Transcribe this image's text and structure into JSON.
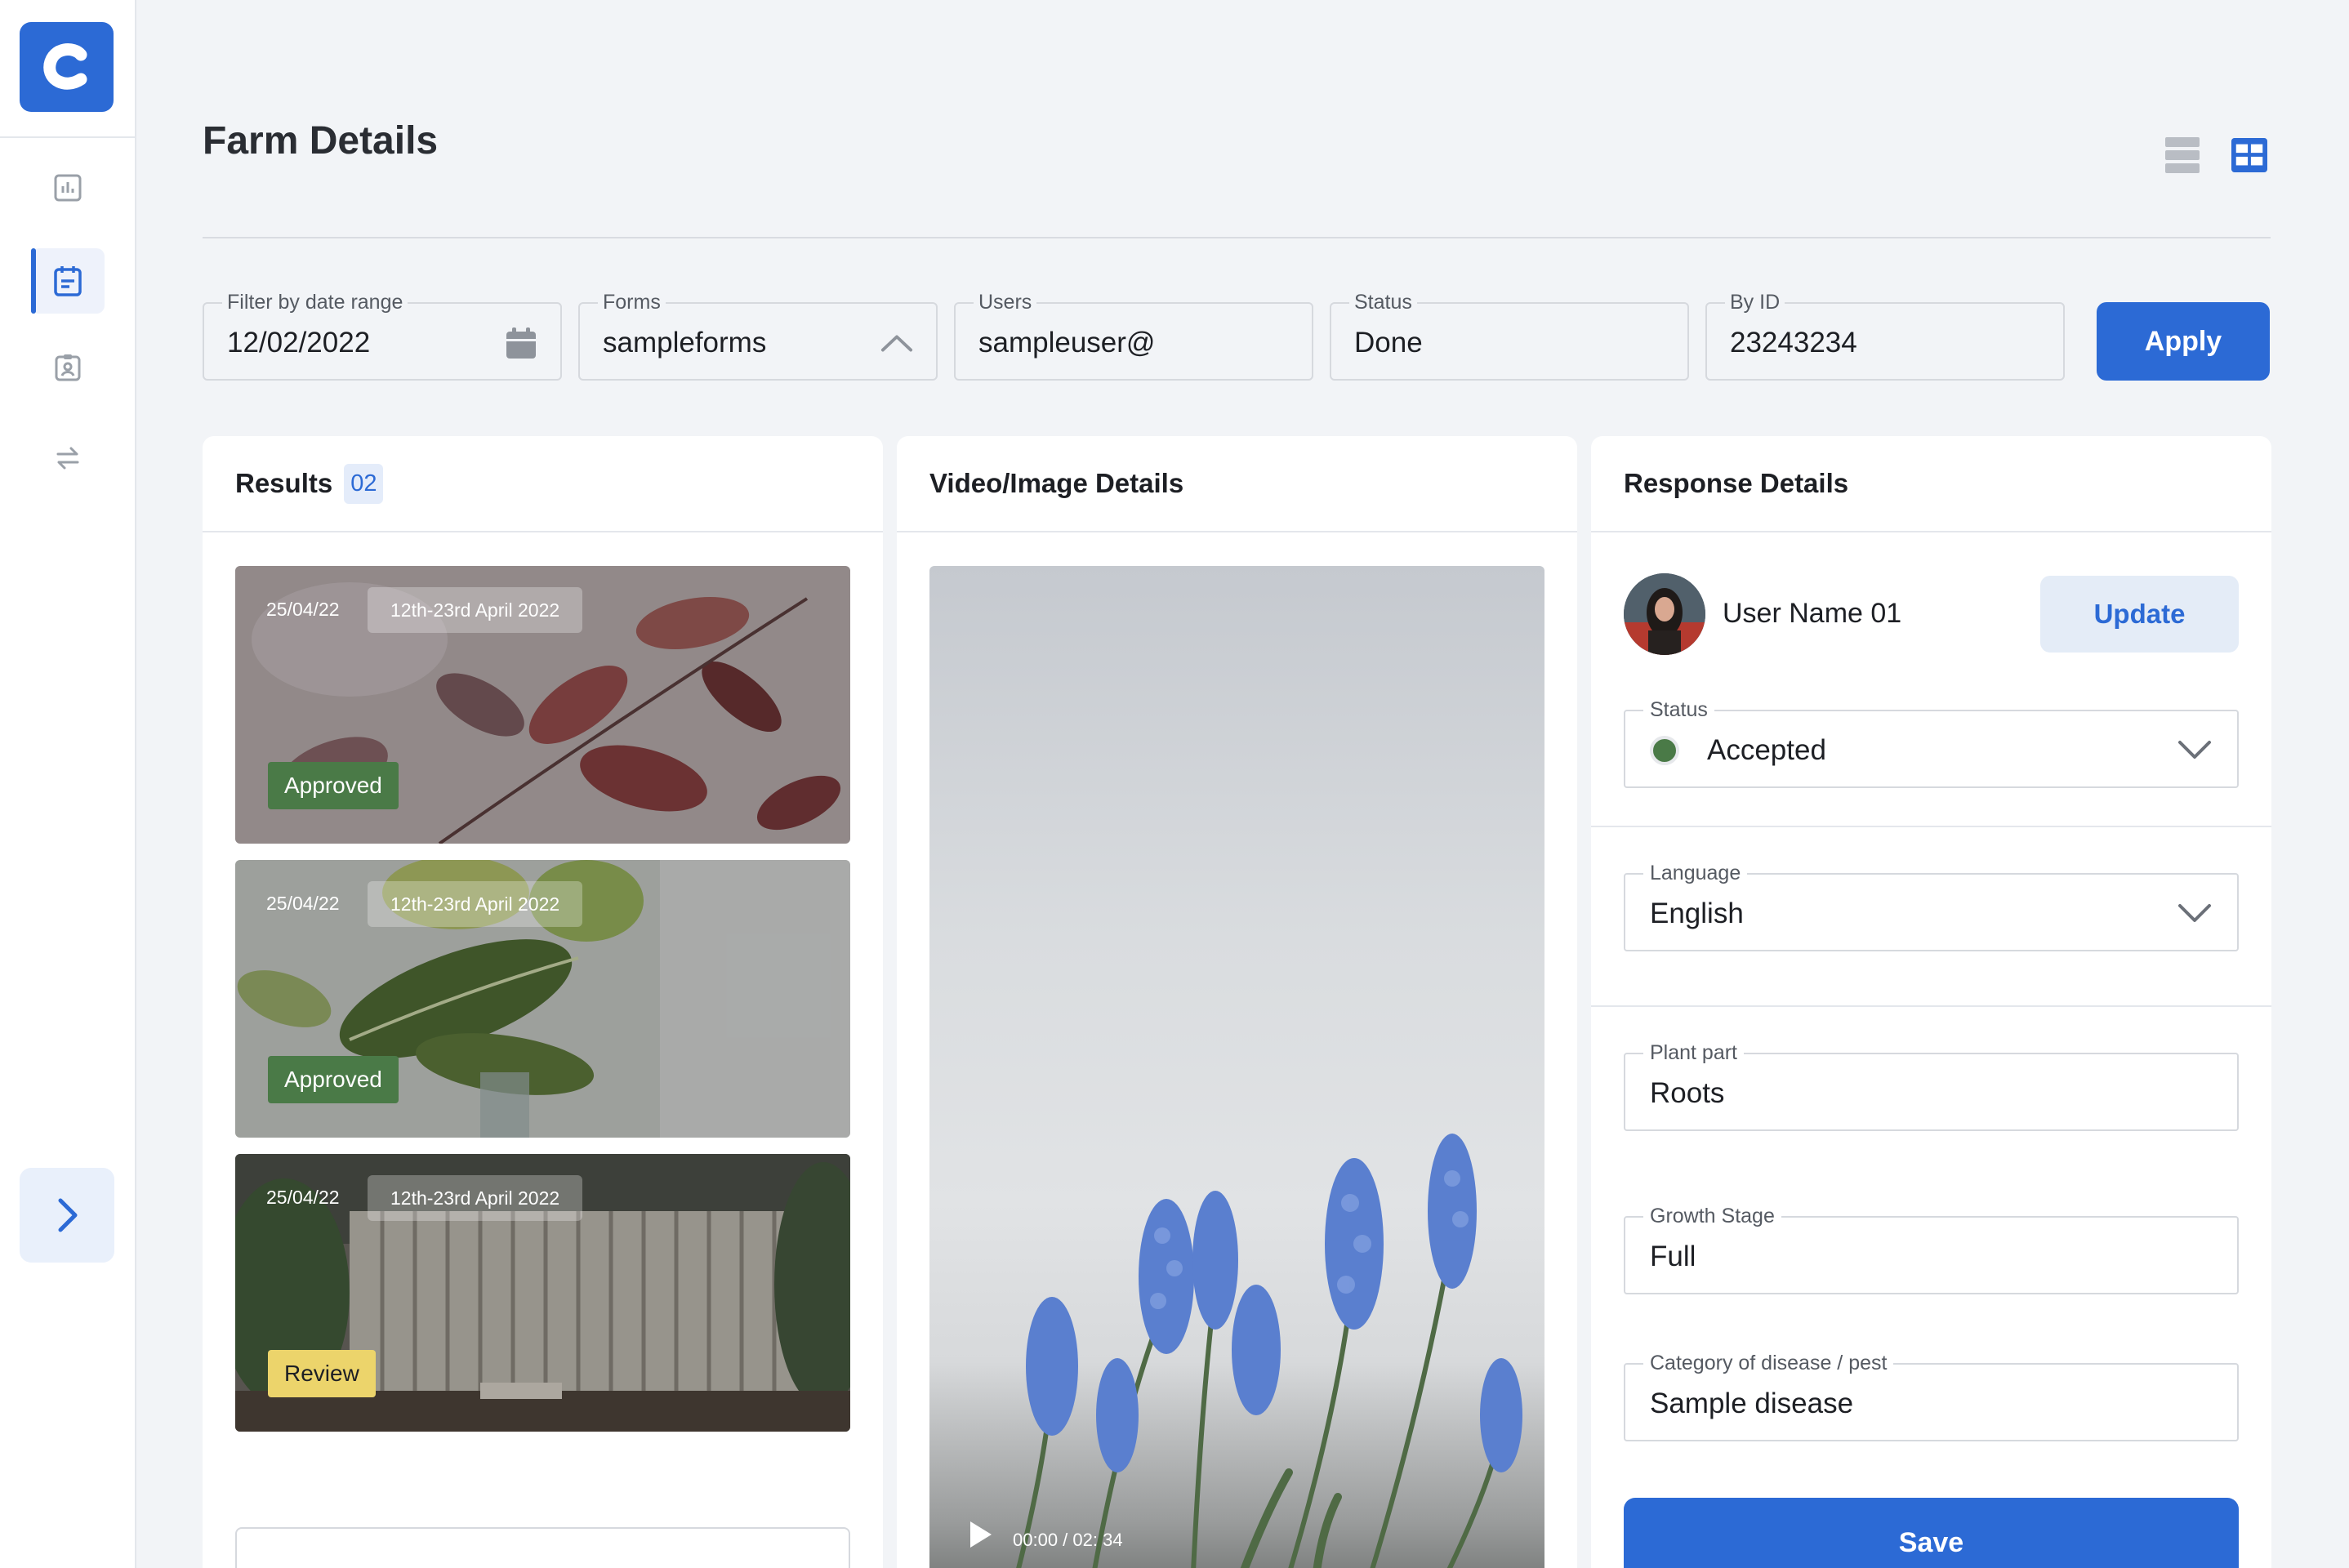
{
  "page": {
    "title": "Farm Details"
  },
  "colors": {
    "accent": "#2c6ad5",
    "approved": "#4a7a47",
    "review": "#ecd46b"
  },
  "sidebar": {
    "logo_icon": "c-logo-icon",
    "items": [
      {
        "icon": "bar-chart-icon",
        "active": false
      },
      {
        "icon": "clipboard-icon",
        "active": true
      },
      {
        "icon": "id-badge-icon",
        "active": false
      },
      {
        "icon": "transfer-arrows-icon",
        "active": false
      }
    ],
    "expand_icon": "chevron-right-icon"
  },
  "view_toggle": {
    "list_icon": "list-view-icon",
    "grid_icon": "grid-view-icon",
    "selected": "grid"
  },
  "filters": {
    "date": {
      "label": "Filter by date range",
      "value": "12/02/2022",
      "icon": "calendar-icon"
    },
    "forms": {
      "label": "Forms",
      "value": "sampleforms",
      "icon": "chevron-up-icon"
    },
    "users": {
      "label": "Users",
      "value": "sampleuser@"
    },
    "status": {
      "label": "Status",
      "value": "Done"
    },
    "by_id": {
      "label": "By ID",
      "value": "23243234"
    },
    "apply_label": "Apply"
  },
  "results": {
    "title": "Results",
    "count": "02",
    "items": [
      {
        "date": "25/04/22",
        "range": "12th-23rd April 2022",
        "status": "Approved"
      },
      {
        "date": "25/04/22",
        "range": "12th-23rd April 2022",
        "status": "Approved"
      },
      {
        "date": "25/04/22",
        "range": "12th-23rd April 2022",
        "status": "Review"
      }
    ]
  },
  "video": {
    "title": "Video/Image Details",
    "time": "00:00 / 02: 34",
    "play_icon": "play-icon"
  },
  "response": {
    "title": "Response Details",
    "user_name": "User Name 01",
    "update_label": "Update",
    "status": {
      "label": "Status",
      "value": "Accepted"
    },
    "language": {
      "label": "Language",
      "value": "English"
    },
    "plant_part": {
      "label": "Plant part",
      "value": "Roots"
    },
    "growth_stage": {
      "label": "Growth Stage",
      "value": "Full"
    },
    "category": {
      "label": "Category of disease / pest",
      "value": "Sample disease"
    },
    "save_label": "Save"
  }
}
